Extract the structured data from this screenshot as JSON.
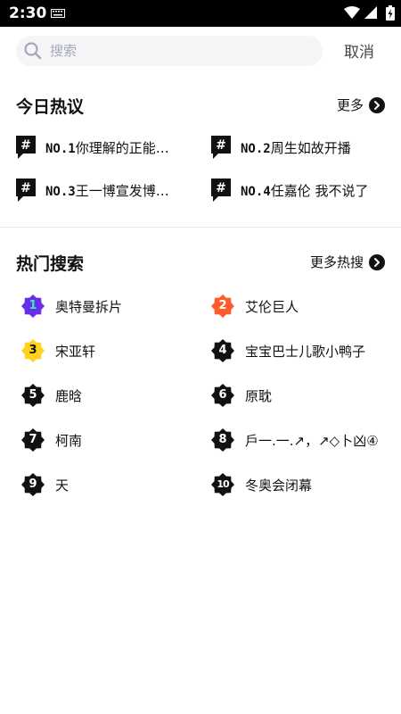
{
  "status": {
    "time": "2:30"
  },
  "search": {
    "placeholder": "搜索",
    "value": "",
    "cancel_label": "取消"
  },
  "today": {
    "title": "今日热议",
    "more_label": "更多",
    "topics": [
      {
        "rank": "NO.1",
        "title": "你理解的正能…"
      },
      {
        "rank": "NO.2",
        "title": "周生如故开播"
      },
      {
        "rank": "NO.3",
        "title": "王一博宣发博…"
      },
      {
        "rank": "NO.4",
        "title": "任嘉伦 我不说了"
      }
    ]
  },
  "hot": {
    "title": "热门搜索",
    "more_label": "更多热搜",
    "items": [
      {
        "num": "1",
        "label": "奥特曼拆片"
      },
      {
        "num": "2",
        "label": "艾伦巨人"
      },
      {
        "num": "3",
        "label": "宋亚轩"
      },
      {
        "num": "4",
        "label": "宝宝巴士儿歌小鸭子"
      },
      {
        "num": "5",
        "label": "鹿晗"
      },
      {
        "num": "6",
        "label": "原耽"
      },
      {
        "num": "7",
        "label": "柯南"
      },
      {
        "num": "8",
        "label": "戶一.一.↗，↗◇卜凶④"
      },
      {
        "num": "9",
        "label": "天"
      },
      {
        "num": "10",
        "label": "冬奥会闭幕"
      }
    ]
  },
  "colors": {
    "rank1": "#6b2ee8",
    "rank1_text": "#3ee6c8",
    "rank2": "#ff5c2e",
    "rank3": "#ffd21e",
    "rank_default": "#111111",
    "topic_highlight": "#c8f5d8"
  }
}
